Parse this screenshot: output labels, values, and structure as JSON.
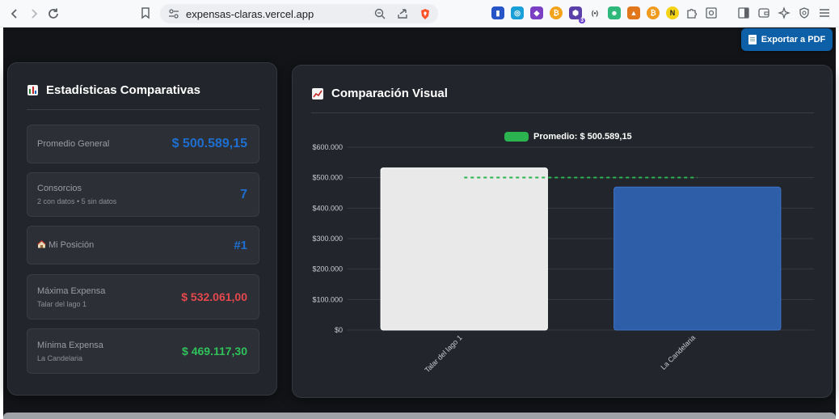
{
  "browser": {
    "url": "expensas-claras.vercel.app",
    "extension_badge": "3"
  },
  "page": {
    "export_button": "Exportar a PDF"
  },
  "stats_panel": {
    "title": "Estadísticas Comparativas",
    "cards": [
      {
        "label": "Promedio General",
        "sub": "",
        "value": "$ 500.589,15",
        "color": "#1e6fd0"
      },
      {
        "label": "Consorcios",
        "sub": "2 con datos • 5 sin datos",
        "value": "7",
        "color": "#1e6fd0"
      },
      {
        "label": "Mi Posición",
        "sub": "",
        "value": "#1",
        "color": "#1e6fd0"
      },
      {
        "label": "Máxima Expensa",
        "sub": "Talar del lago 1",
        "value": "$ 532.061,00",
        "color": "#e5484d"
      },
      {
        "label": "Mínima Expensa",
        "sub": "La Candelaria",
        "value": "$ 469.117,30",
        "color": "#2fc25b"
      }
    ]
  },
  "visual_panel": {
    "title": "Comparación Visual"
  },
  "chart_data": {
    "type": "bar",
    "categories": [
      "Talar del lago 1",
      "La Candelaria"
    ],
    "values": [
      532061.0,
      469117.3
    ],
    "bar_colors": [
      "#e9e9e9",
      "#2e5ea8"
    ],
    "ylim": [
      0,
      600000
    ],
    "yticks": [
      0,
      100000,
      200000,
      300000,
      400000,
      500000,
      600000
    ],
    "ytick_labels": [
      "$0",
      "$100.000",
      "$200.000",
      "$300.000",
      "$400.000",
      "$500.000",
      "$600.000"
    ],
    "average": 500589.15,
    "legend": "Promedio: $ 500.589,15",
    "average_color": "#2bb34f",
    "grid": true
  }
}
